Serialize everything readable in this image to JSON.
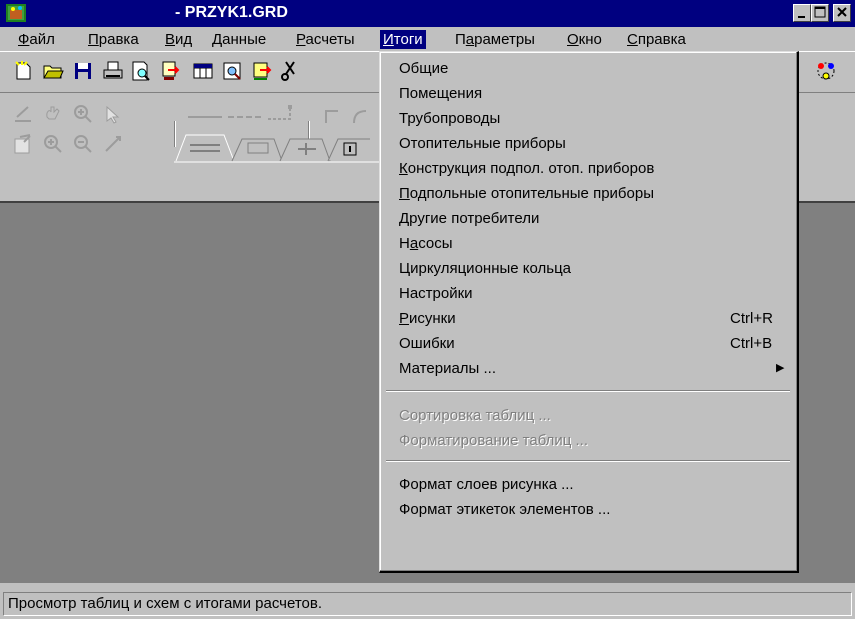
{
  "window": {
    "title": "- PRZYK1.GRD"
  },
  "menubar": {
    "items": [
      {
        "pre": "",
        "u": "Ф",
        "post": "айл"
      },
      {
        "pre": "",
        "u": "П",
        "post": "равка"
      },
      {
        "pre": "",
        "u": "В",
        "post": "ид"
      },
      {
        "pre": "",
        "u": "Д",
        "post": "анные"
      },
      {
        "pre": "",
        "u": "Р",
        "post": "асчеты"
      },
      {
        "pre": "",
        "u": "И",
        "post": "тоги"
      },
      {
        "pre": "П",
        "u": "а",
        "post": "раметры"
      },
      {
        "pre": "",
        "u": "О",
        "post": "кно"
      },
      {
        "pre": "",
        "u": "С",
        "post": "правка"
      }
    ]
  },
  "menu": {
    "items": [
      {
        "pre": "Общие",
        "u": "",
        "post": "",
        "accel": ""
      },
      {
        "pre": "Помещения",
        "u": "",
        "post": "",
        "accel": ""
      },
      {
        "pre": "Трубопроводы",
        "u": "",
        "post": "",
        "accel": ""
      },
      {
        "pre": "Отопительные приборы",
        "u": "",
        "post": "",
        "accel": ""
      },
      {
        "pre": "",
        "u": "К",
        "post": "онструкция подпол. отоп. приборов",
        "accel": ""
      },
      {
        "pre": "",
        "u": "П",
        "post": "одпольные отопительные приборы",
        "accel": ""
      },
      {
        "pre": "Другие потребители",
        "u": "",
        "post": "",
        "accel": ""
      },
      {
        "pre": "Н",
        "u": "а",
        "post": "сосы",
        "accel": ""
      },
      {
        "pre": "Циркуляционные кольца",
        "u": "",
        "post": "",
        "accel": ""
      },
      {
        "pre": "Настройки",
        "u": "",
        "post": "",
        "accel": ""
      },
      {
        "pre": "",
        "u": "Р",
        "post": "исунки",
        "accel": "Ctrl+R"
      },
      {
        "pre": "Ошибки",
        "u": "",
        "post": "",
        "accel": "Ctrl+B"
      },
      {
        "pre": "Материалы ...",
        "u": "",
        "post": "",
        "accel": ""
      },
      {
        "pre": "Сортировка таблиц ...",
        "u": "",
        "post": "",
        "accel": ""
      },
      {
        "pre": "Форматирование таблиц ...",
        "u": "",
        "post": "",
        "accel": ""
      },
      {
        "pre": "Формат слоев рисунка ...",
        "u": "",
        "post": "",
        "accel": ""
      },
      {
        "pre": "Формат этикеток элементов ...",
        "u": "",
        "post": "",
        "accel": ""
      }
    ]
  },
  "status": {
    "text": "Просмотр таблиц и схем с итогами расчетов."
  }
}
